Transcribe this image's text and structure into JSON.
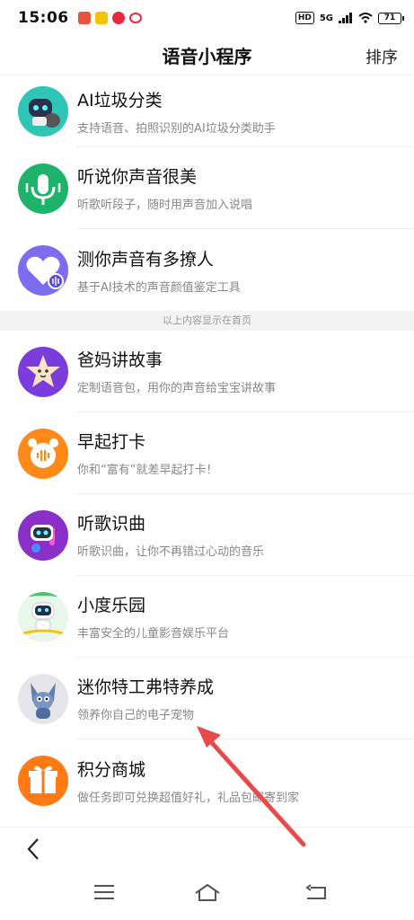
{
  "status_bar": {
    "time": "15:06",
    "signal": "5G",
    "battery": "71",
    "hd": "HD"
  },
  "header": {
    "title": "语音小程序",
    "sort_label": "排序"
  },
  "items_top": [
    {
      "name": "AI垃圾分类",
      "desc": "支持语音、拍照识别的AI垃圾分类助手",
      "icon": "robot-trash-icon",
      "color": "#2ec4b6"
    },
    {
      "name": "听说你声音很美",
      "desc": "听歌听段子，随时用声音加入说唱",
      "icon": "microphone-icon",
      "color": "#1db36b"
    },
    {
      "name": "测你声音有多撩人",
      "desc": "基于AI技术的声音颜值鉴定工具",
      "icon": "heart-voice-icon",
      "color": "#7b6cf0"
    }
  ],
  "section_divider": "以上内容显示在首页",
  "items_bottom": [
    {
      "name": "爸妈讲故事",
      "desc": "定制语音包，用你的声音给宝宝讲故事",
      "icon": "star-face-icon",
      "color": "#7a3ddb"
    },
    {
      "name": "早起打卡",
      "desc": "你和“富有”就差早起打卡！",
      "icon": "alarm-clock-icon",
      "color": "#ff8a1a"
    },
    {
      "name": "听歌识曲",
      "desc": "听歌识曲，让你不再错过心动的音乐",
      "icon": "robot-music-icon",
      "color": "#8b2fc9"
    },
    {
      "name": "小度乐园",
      "desc": "丰富安全的儿童影音娱乐平台",
      "icon": "robot-park-icon",
      "color": "#4fc36a"
    },
    {
      "name": "迷你特工弗特养成",
      "desc": "领养你自己的电子宠物",
      "icon": "pet-agent-icon",
      "color": "#c9d6e8"
    },
    {
      "name": "积分商城",
      "desc": "做任务即可兑换超值好礼，礼品包邮寄到家",
      "icon": "gift-box-icon",
      "color": "#ff7a12"
    }
  ],
  "annotation": {
    "color": "#e84a4a"
  }
}
